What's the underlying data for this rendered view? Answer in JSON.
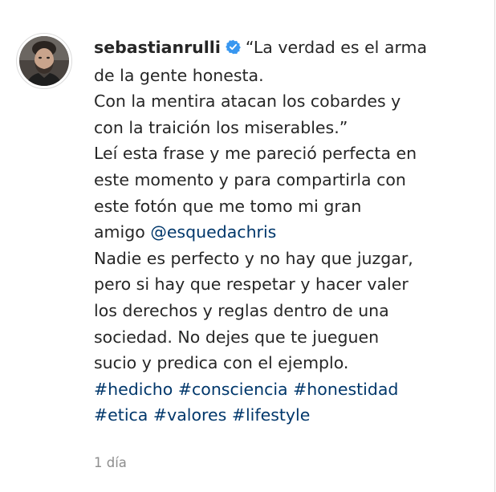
{
  "post": {
    "username": "sebastianrulli",
    "verified_icon": "verified-badge-icon",
    "avatar_icon": "profile-avatar",
    "lines": {
      "l1": "“La verdad es el arma",
      "l2": "de la gente honesta.",
      "l3": "Con la mentira atacan los cobardes y",
      "l4": "con la traición los miserables.”",
      "l5": "Leí esta frase y me pareció perfecta en",
      "l6": "este momento y para compartirla con",
      "l7": "este fotón que me tomo mi gran",
      "l8_prefix": "amigo ",
      "mention": "@esquedachris",
      "l9": "Nadie es perfecto y no hay que juzgar,",
      "l10": "pero si hay que respetar y hacer valer",
      "l11": "los derechos y reglas dentro de una",
      "l12": "sociedad. No dejes que te jueguen",
      "l13": "sucio y predica con el ejemplo."
    },
    "hashtags": {
      "h1": "#hedicho",
      "h2": "#consciencia",
      "h3": "#honestidad",
      "h4": "#etica",
      "h5": "#valores",
      "h6": "#lifestyle"
    },
    "timestamp": "1 día"
  },
  "colors": {
    "text": "#262626",
    "link": "#00376b",
    "muted": "#8e8e8e",
    "verified": "#3897f0",
    "border": "#dbdbdb"
  }
}
